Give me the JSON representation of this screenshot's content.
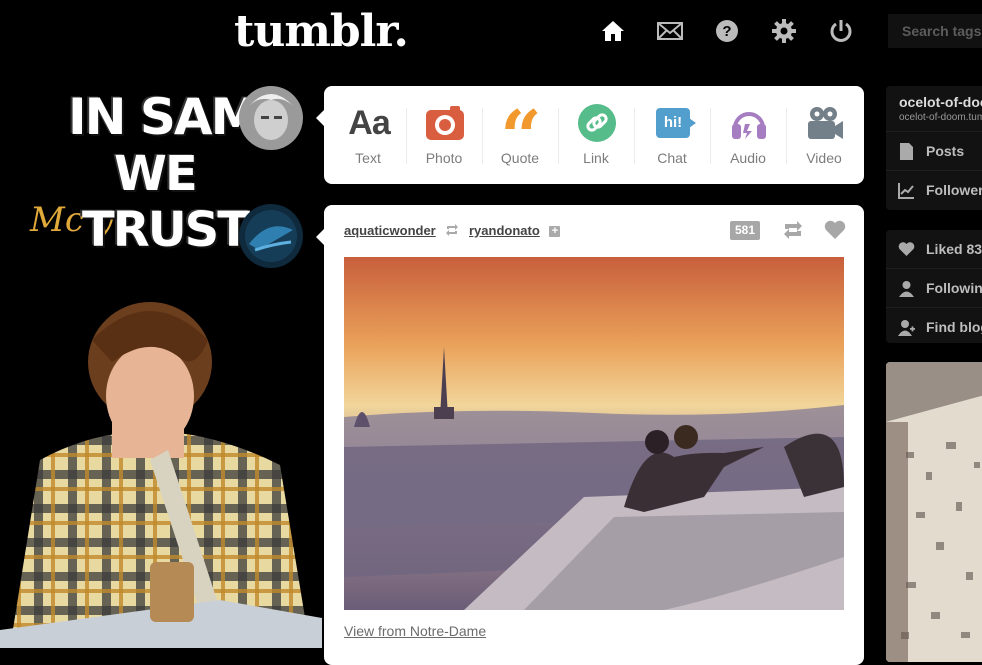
{
  "header": {
    "logo": "tumblr.",
    "search_placeholder": "Search tags",
    "nav": [
      "home-icon",
      "mail-icon",
      "help-icon",
      "settings-icon",
      "power-icon"
    ]
  },
  "art": {
    "line1": "IN SAM",
    "line2": "WE",
    "line3": "TRUST",
    "script": "Mc            y"
  },
  "composer": {
    "types": [
      {
        "label": "Text",
        "glyph": "Aa"
      },
      {
        "label": "Photo"
      },
      {
        "label": "Quote",
        "glyph": "“"
      },
      {
        "label": "Link"
      },
      {
        "label": "Chat",
        "glyph": "hi!"
      },
      {
        "label": "Audio"
      },
      {
        "label": "Video"
      }
    ],
    "colors": {
      "text": "#444444",
      "photo": "#d95e40",
      "quote": "#f2992e",
      "link": "#56bc8a",
      "chat": "#529ecc",
      "audio": "#a77dc2",
      "video": "#748089"
    }
  },
  "post": {
    "author": "aquaticwonder",
    "reblogged_from": "ryandonato",
    "notes": "581",
    "caption": "View from Notre-Dame"
  },
  "sidebar": {
    "blog_name": "ocelot-of-doom",
    "blog_url": "ocelot-of-doom.tumblr.com",
    "rows1": [
      "Posts",
      "Followers"
    ],
    "rows2": [
      "Liked 83",
      "Following",
      "Find blogs"
    ]
  }
}
